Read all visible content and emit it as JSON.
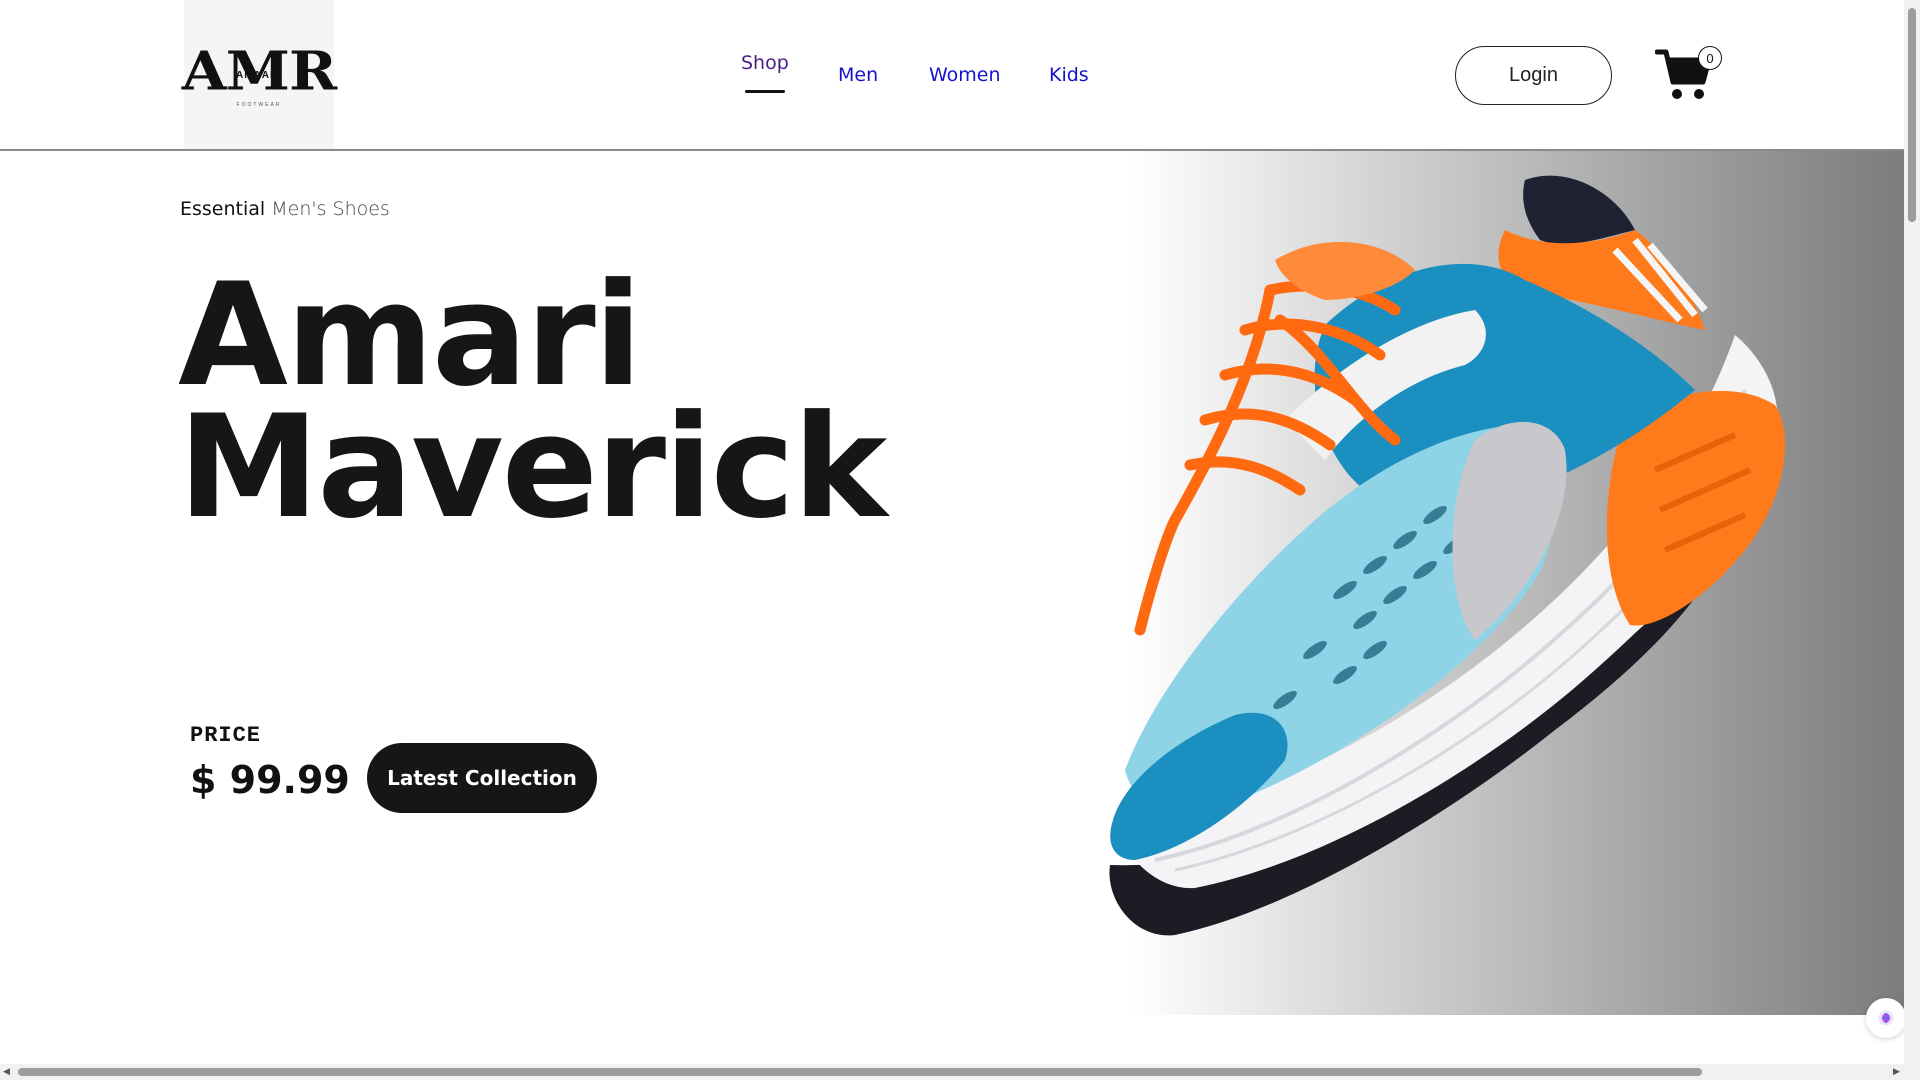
{
  "brand": {
    "logo_mark": "AMR",
    "logo_sub": "AMAARI",
    "logo_tagline": "FOOTWEAR"
  },
  "nav": {
    "items": [
      {
        "label": "Shop",
        "active": true
      },
      {
        "label": "Men"
      },
      {
        "label": "Women"
      },
      {
        "label": "Kids"
      }
    ]
  },
  "header": {
    "login_label": "Login",
    "cart_count": "0"
  },
  "hero": {
    "eyebrow_strong": "Essential",
    "eyebrow_light": "Men's Shoes",
    "title_line1": "Amari",
    "title_line2": "Maverick",
    "price_label": "PRICE",
    "price_value": "$ 99.99",
    "cta_label": "Latest Collection",
    "product_image": "running-shoe-orange-blue"
  },
  "colors": {
    "nav_active": "#4b1e86",
    "nav_link": "#1414cc",
    "cta_bg": "#161616",
    "shoe_orange": "#ff7a1a",
    "shoe_blue": "#1a8fc0",
    "shoe_light_blue": "#8fd3e6"
  },
  "icons": {
    "cart": "shopping-cart-icon",
    "widget": "assistant-icon"
  }
}
